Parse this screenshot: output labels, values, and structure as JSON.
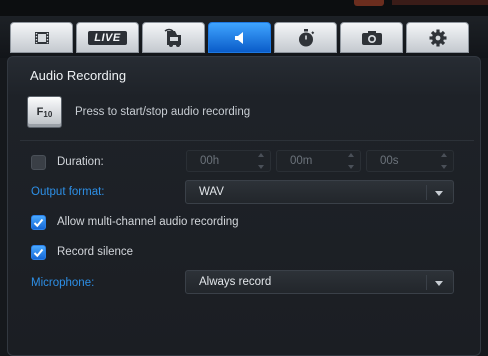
{
  "tabs": [
    {
      "icon": "film-icon"
    },
    {
      "icon": "live-icon",
      "label": "LIVE"
    },
    {
      "icon": "game-icon"
    },
    {
      "icon": "speaker-icon",
      "active": true
    },
    {
      "icon": "stopwatch-icon"
    },
    {
      "icon": "camera-icon"
    },
    {
      "icon": "gear-icon"
    }
  ],
  "section": {
    "title": "Audio Recording",
    "hotkey_main": "F",
    "hotkey_sub": "10",
    "hotkey_hint": "Press to start/stop audio recording"
  },
  "duration": {
    "label": "Duration:",
    "checked": false,
    "hours": "00h",
    "minutes": "00m",
    "seconds": "00s"
  },
  "output_format": {
    "label": "Output format:",
    "value": "WAV"
  },
  "multichannel": {
    "label": "Allow multi-channel audio recording",
    "checked": true
  },
  "record_silence": {
    "label": "Record silence",
    "checked": true
  },
  "microphone": {
    "label": "Microphone:",
    "value": "Always record"
  },
  "colors": {
    "accent": "#1a7ae8",
    "label_blue": "#2d8fe6",
    "panel_bg": "#1b1e23"
  }
}
